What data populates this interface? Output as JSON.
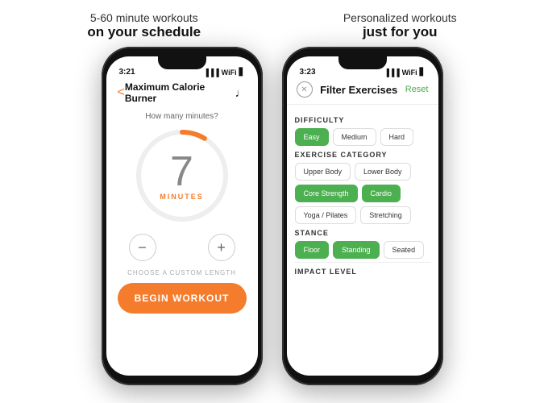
{
  "left_headline": {
    "sub": "5-60 minute workouts",
    "main": "on your schedule"
  },
  "right_headline": {
    "sub": "Personalized workouts",
    "main": "just for you"
  },
  "phone1": {
    "status_time": "3:21",
    "nav_title": "Maximum Calorie Burner",
    "back_label": "<",
    "prompt": "How many minutes?",
    "timer_number": "7",
    "timer_unit": "MINUTES",
    "minus_label": "−",
    "plus_label": "+",
    "custom_link": "CHOOSE A CUSTOM LENGTH",
    "begin_btn": "BEGIN WORKOUT"
  },
  "phone2": {
    "status_time": "3:23",
    "filter_title": "Filter Exercises",
    "reset_label": "Reset",
    "sections": [
      {
        "name": "DIFFICULTY",
        "pills": [
          {
            "label": "Easy",
            "active": true
          },
          {
            "label": "Medium",
            "active": false
          },
          {
            "label": "Hard",
            "active": false
          }
        ]
      },
      {
        "name": "EXERCISE CATEGORY",
        "pills": [
          {
            "label": "Upper Body",
            "active": false
          },
          {
            "label": "Lower Body",
            "active": false
          },
          {
            "label": "Core Strength",
            "active": true
          },
          {
            "label": "Cardio",
            "active": true
          },
          {
            "label": "Yoga / Pilates",
            "active": false
          },
          {
            "label": "Stretching",
            "active": false
          }
        ]
      },
      {
        "name": "STANCE",
        "pills": [
          {
            "label": "Floor",
            "active": true
          },
          {
            "label": "Standing",
            "active": true
          },
          {
            "label": "Seated",
            "active": false
          }
        ]
      },
      {
        "name": "IMPACT LEVEL",
        "pills": []
      }
    ]
  },
  "colors": {
    "orange": "#f47c2c",
    "green": "#4caf50"
  }
}
